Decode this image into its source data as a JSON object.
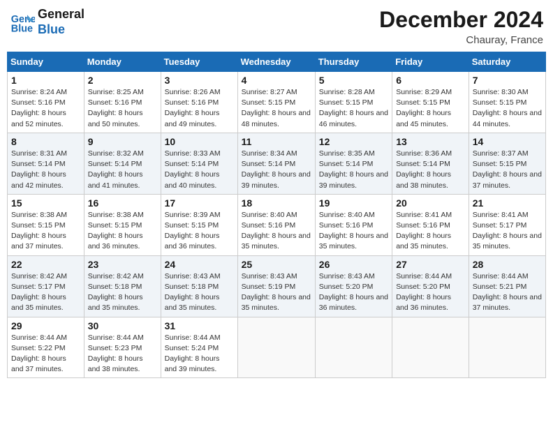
{
  "header": {
    "logo_line1": "General",
    "logo_line2": "Blue",
    "month_year": "December 2024",
    "location": "Chauray, France"
  },
  "calendar": {
    "days_of_week": [
      "Sunday",
      "Monday",
      "Tuesday",
      "Wednesday",
      "Thursday",
      "Friday",
      "Saturday"
    ],
    "weeks": [
      [
        {
          "day": "1",
          "sunrise": "8:24 AM",
          "sunset": "5:16 PM",
          "daylight": "8 hours and 52 minutes."
        },
        {
          "day": "2",
          "sunrise": "8:25 AM",
          "sunset": "5:16 PM",
          "daylight": "8 hours and 50 minutes."
        },
        {
          "day": "3",
          "sunrise": "8:26 AM",
          "sunset": "5:16 PM",
          "daylight": "8 hours and 49 minutes."
        },
        {
          "day": "4",
          "sunrise": "8:27 AM",
          "sunset": "5:15 PM",
          "daylight": "8 hours and 48 minutes."
        },
        {
          "day": "5",
          "sunrise": "8:28 AM",
          "sunset": "5:15 PM",
          "daylight": "8 hours and 46 minutes."
        },
        {
          "day": "6",
          "sunrise": "8:29 AM",
          "sunset": "5:15 PM",
          "daylight": "8 hours and 45 minutes."
        },
        {
          "day": "7",
          "sunrise": "8:30 AM",
          "sunset": "5:15 PM",
          "daylight": "8 hours and 44 minutes."
        }
      ],
      [
        {
          "day": "8",
          "sunrise": "8:31 AM",
          "sunset": "5:14 PM",
          "daylight": "8 hours and 42 minutes."
        },
        {
          "day": "9",
          "sunrise": "8:32 AM",
          "sunset": "5:14 PM",
          "daylight": "8 hours and 41 minutes."
        },
        {
          "day": "10",
          "sunrise": "8:33 AM",
          "sunset": "5:14 PM",
          "daylight": "8 hours and 40 minutes."
        },
        {
          "day": "11",
          "sunrise": "8:34 AM",
          "sunset": "5:14 PM",
          "daylight": "8 hours and 39 minutes."
        },
        {
          "day": "12",
          "sunrise": "8:35 AM",
          "sunset": "5:14 PM",
          "daylight": "8 hours and 39 minutes."
        },
        {
          "day": "13",
          "sunrise": "8:36 AM",
          "sunset": "5:14 PM",
          "daylight": "8 hours and 38 minutes."
        },
        {
          "day": "14",
          "sunrise": "8:37 AM",
          "sunset": "5:15 PM",
          "daylight": "8 hours and 37 minutes."
        }
      ],
      [
        {
          "day": "15",
          "sunrise": "8:38 AM",
          "sunset": "5:15 PM",
          "daylight": "8 hours and 37 minutes."
        },
        {
          "day": "16",
          "sunrise": "8:38 AM",
          "sunset": "5:15 PM",
          "daylight": "8 hours and 36 minutes."
        },
        {
          "day": "17",
          "sunrise": "8:39 AM",
          "sunset": "5:15 PM",
          "daylight": "8 hours and 36 minutes."
        },
        {
          "day": "18",
          "sunrise": "8:40 AM",
          "sunset": "5:16 PM",
          "daylight": "8 hours and 35 minutes."
        },
        {
          "day": "19",
          "sunrise": "8:40 AM",
          "sunset": "5:16 PM",
          "daylight": "8 hours and 35 minutes."
        },
        {
          "day": "20",
          "sunrise": "8:41 AM",
          "sunset": "5:16 PM",
          "daylight": "8 hours and 35 minutes."
        },
        {
          "day": "21",
          "sunrise": "8:41 AM",
          "sunset": "5:17 PM",
          "daylight": "8 hours and 35 minutes."
        }
      ],
      [
        {
          "day": "22",
          "sunrise": "8:42 AM",
          "sunset": "5:17 PM",
          "daylight": "8 hours and 35 minutes."
        },
        {
          "day": "23",
          "sunrise": "8:42 AM",
          "sunset": "5:18 PM",
          "daylight": "8 hours and 35 minutes."
        },
        {
          "day": "24",
          "sunrise": "8:43 AM",
          "sunset": "5:18 PM",
          "daylight": "8 hours and 35 minutes."
        },
        {
          "day": "25",
          "sunrise": "8:43 AM",
          "sunset": "5:19 PM",
          "daylight": "8 hours and 35 minutes."
        },
        {
          "day": "26",
          "sunrise": "8:43 AM",
          "sunset": "5:20 PM",
          "daylight": "8 hours and 36 minutes."
        },
        {
          "day": "27",
          "sunrise": "8:44 AM",
          "sunset": "5:20 PM",
          "daylight": "8 hours and 36 minutes."
        },
        {
          "day": "28",
          "sunrise": "8:44 AM",
          "sunset": "5:21 PM",
          "daylight": "8 hours and 37 minutes."
        }
      ],
      [
        {
          "day": "29",
          "sunrise": "8:44 AM",
          "sunset": "5:22 PM",
          "daylight": "8 hours and 37 minutes."
        },
        {
          "day": "30",
          "sunrise": "8:44 AM",
          "sunset": "5:23 PM",
          "daylight": "8 hours and 38 minutes."
        },
        {
          "day": "31",
          "sunrise": "8:44 AM",
          "sunset": "5:24 PM",
          "daylight": "8 hours and 39 minutes."
        },
        null,
        null,
        null,
        null
      ]
    ]
  },
  "labels": {
    "sunrise": "Sunrise: ",
    "sunset": "Sunset: ",
    "daylight": "Daylight: "
  }
}
